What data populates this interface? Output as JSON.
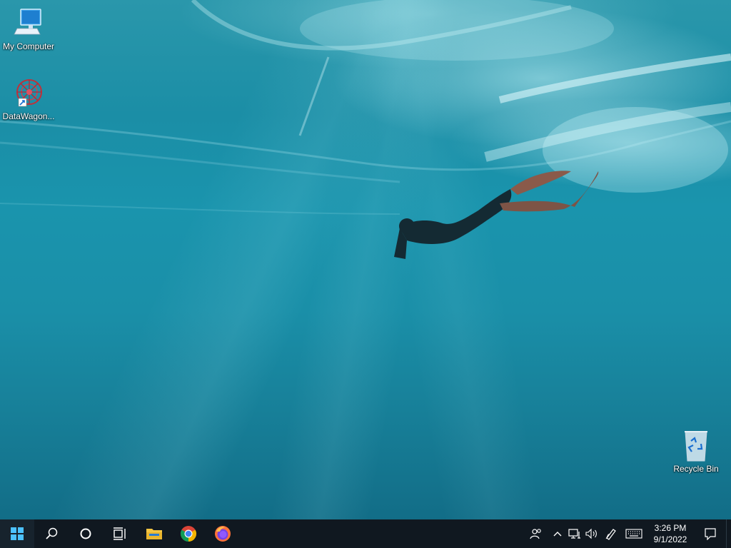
{
  "desktop": {
    "icons": [
      {
        "label": "My Computer",
        "icon": "computer-icon"
      },
      {
        "label": "DataWagon...",
        "icon": "datawagon-icon"
      },
      {
        "label": "Recycle Bin",
        "icon": "recycle-bin-icon"
      }
    ]
  },
  "taskbar": {
    "start": {
      "icon": "windows-logo-icon"
    },
    "search": {
      "icon": "search-icon"
    },
    "cortana": {
      "icon": "cortana-circle-icon"
    },
    "task_view": {
      "icon": "task-view-icon"
    },
    "pinned": [
      {
        "name": "File Explorer",
        "icon": "folder-icon"
      },
      {
        "name": "Google Chrome",
        "icon": "chrome-icon"
      },
      {
        "name": "Firefox",
        "icon": "firefox-icon"
      }
    ],
    "tray": {
      "icons": [
        "people-icon",
        "chevron-up-icon",
        "network-icon",
        "volume-icon",
        "pen-icon",
        "keyboard-icon"
      ],
      "time": "3:26 PM",
      "date": "9/1/2022",
      "notification_icon": "action-center-icon"
    }
  },
  "colors": {
    "taskbar": "#101820",
    "water_top": "#2a97ab",
    "water_bottom": "#126d87"
  }
}
